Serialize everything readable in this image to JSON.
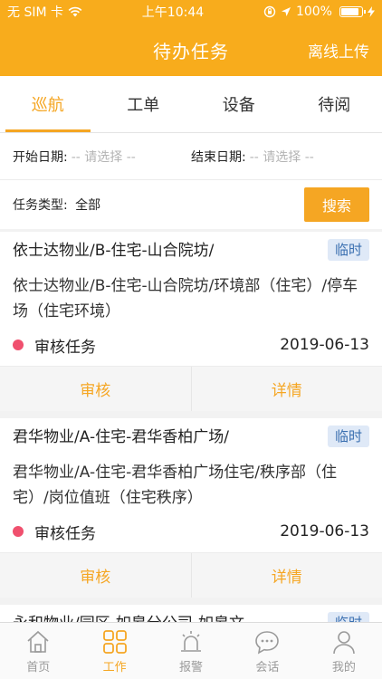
{
  "status_bar": {
    "carrier": "无 SIM 卡",
    "time": "上午10:44",
    "battery": "100%"
  },
  "header": {
    "title": "待办任务",
    "action": "离线上传"
  },
  "tabs": [
    {
      "label": "巡航",
      "active": true
    },
    {
      "label": "工单",
      "active": false
    },
    {
      "label": "设备",
      "active": false
    },
    {
      "label": "待阅",
      "active": false
    }
  ],
  "filters": {
    "start_label": "开始日期:",
    "start_placeholder": "-- 请选择 --",
    "end_label": "结束日期:",
    "end_placeholder": "-- 请选择 --",
    "type_label": "任务类型:",
    "type_value": "全部",
    "search_label": "搜索"
  },
  "tasks": [
    {
      "title": "依士达物业/B-住宅-山合院坊/",
      "tag": "临时",
      "description": "依士达物业/B-住宅-山合院坊/环境部（住宅）/停车场（住宅环境）",
      "status": "审核任务",
      "date": "2019-06-13",
      "action_review": "审核",
      "action_detail": "详情"
    },
    {
      "title": "君华物业/A-住宅-君华香柏广场/",
      "tag": "临时",
      "description": "君华物业/A-住宅-君华香柏广场住宅/秩序部（住宅）/岗位值班（住宅秩序）",
      "status": "审核任务",
      "date": "2019-06-13",
      "action_review": "审核",
      "action_detail": "详情"
    },
    {
      "title": "永和物业/园区-如皋分公司-如皋文",
      "tag": "临时",
      "description": "",
      "status": "",
      "date": "",
      "action_review": "",
      "action_detail": ""
    }
  ],
  "tabbar": [
    {
      "label": "首页",
      "icon": "home-icon",
      "active": false
    },
    {
      "label": "工作",
      "icon": "grid-icon",
      "active": true
    },
    {
      "label": "报警",
      "icon": "alarm-icon",
      "active": false
    },
    {
      "label": "会话",
      "icon": "chat-icon",
      "active": false
    },
    {
      "label": "我的",
      "icon": "user-icon",
      "active": false
    }
  ],
  "colors": {
    "accent": "#f5a623",
    "header": "#f8ac1c",
    "tag_bg": "#dfe9f7",
    "tag_text": "#3a6fb0",
    "status_dot": "#f0506e"
  }
}
